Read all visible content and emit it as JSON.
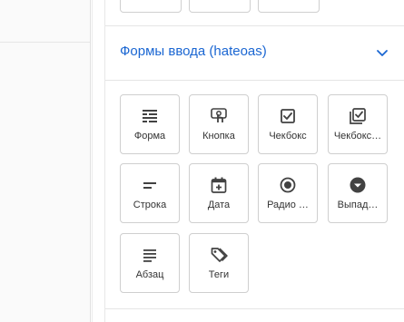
{
  "section": {
    "title": "Формы ввода (hateoas)",
    "expanded": true,
    "title_color": "#1a66d2"
  },
  "tiles": [
    {
      "label": "Форма",
      "icon": "form-icon"
    },
    {
      "label": "Кнопка",
      "icon": "button-touch-icon"
    },
    {
      "label": "Чекбокс",
      "icon": "checkbox-icon"
    },
    {
      "label": "Чекбокс…",
      "icon": "checkbox-multiple-icon"
    },
    {
      "label": "Строка",
      "icon": "short-text-icon"
    },
    {
      "label": "Дата",
      "icon": "calendar-add-icon"
    },
    {
      "label": "Радио …",
      "icon": "radio-icon"
    },
    {
      "label": "Выпад…",
      "icon": "dropdown-icon"
    },
    {
      "label": "Абзац",
      "icon": "paragraph-icon"
    },
    {
      "label": "Теги",
      "icon": "tags-icon"
    }
  ]
}
